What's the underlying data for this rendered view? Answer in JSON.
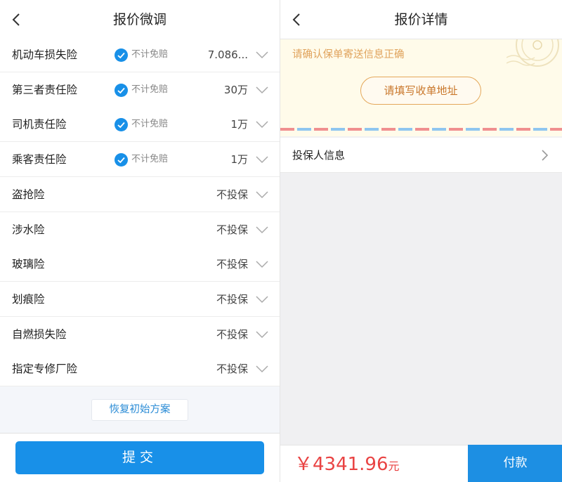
{
  "left": {
    "title": "报价微调",
    "rows": [
      {
        "name": "机动车损失险",
        "deductible": true,
        "value": "7.086..."
      },
      {
        "name": "第三者责任险",
        "deductible": true,
        "value": "30万"
      },
      {
        "name": "司机责任险",
        "deductible": true,
        "value": "1万"
      },
      {
        "name": "乘客责任险",
        "deductible": true,
        "value": "1万"
      },
      {
        "name": "盗抢险",
        "deductible": false,
        "value": "不投保"
      },
      {
        "name": "涉水险",
        "deductible": false,
        "value": "不投保"
      },
      {
        "name": "玻璃险",
        "deductible": false,
        "value": "不投保"
      },
      {
        "name": "划痕险",
        "deductible": false,
        "value": "不投保"
      },
      {
        "name": "自燃损失险",
        "deductible": false,
        "value": "不投保"
      },
      {
        "name": "指定专修厂险",
        "deductible": false,
        "value": "不投保"
      }
    ],
    "deductible_label": "不计免赔",
    "restore_label": "恢复初始方案",
    "submit_label": "提交"
  },
  "right": {
    "title": "报价详情",
    "envelope_hint": "请确认保单寄送信息正确",
    "address_button": "请填写收单地址",
    "insurer_info_label": "投保人信息",
    "price": "￥4341.96",
    "price_unit": "元",
    "pay_label": "付款"
  },
  "colors": {
    "accent": "#1890e8",
    "price": "#e94343",
    "envelope_bg": "#fffbea",
    "envelope_text": "#e0a35c"
  },
  "icons": {
    "back": "chevron-left-icon",
    "check": "check-circle-icon",
    "dropdown": "chevron-down-icon",
    "arrow": "chevron-right-icon"
  }
}
